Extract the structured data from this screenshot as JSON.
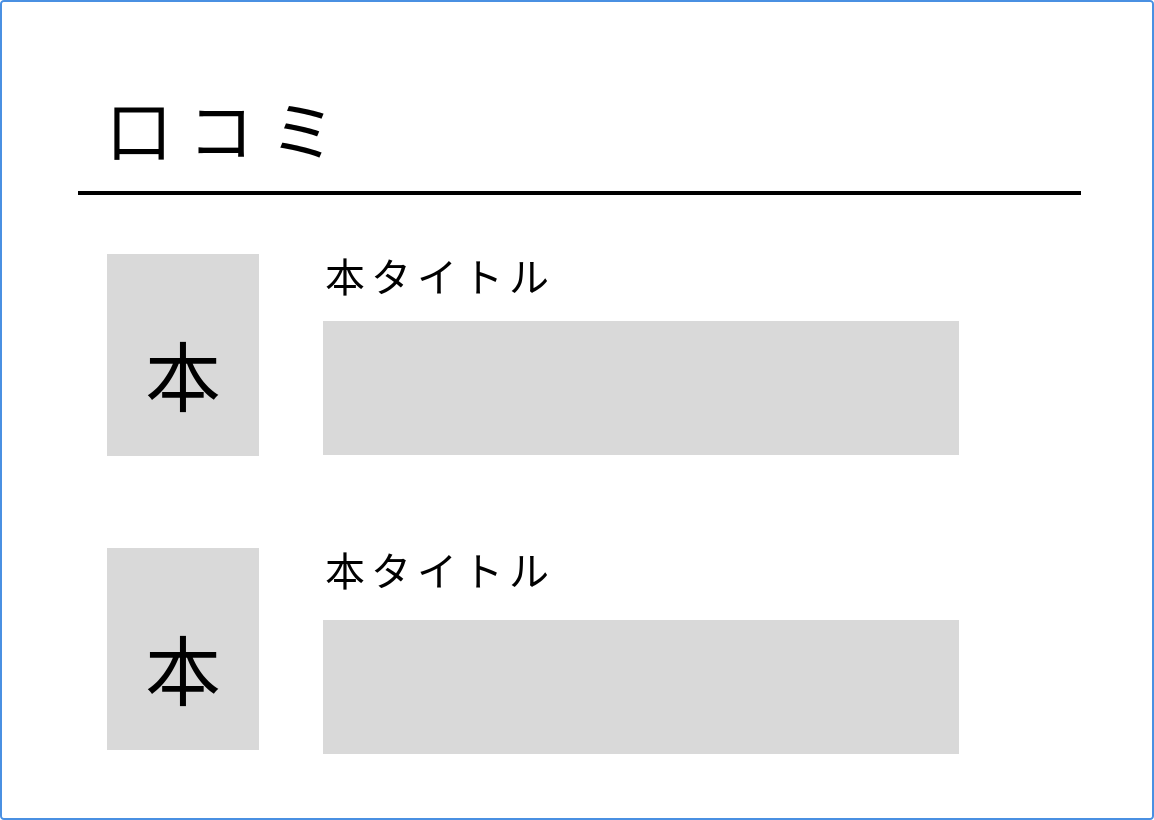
{
  "page": {
    "title": "口コミ"
  },
  "reviews": [
    {
      "cover_label": "本",
      "book_title": "本タイトル",
      "review_text": ""
    },
    {
      "cover_label": "本",
      "book_title": "本タイトル",
      "review_text": ""
    }
  ],
  "colors": {
    "frame_border": "#4a90e2",
    "placeholder_gray": "#d9d9d9",
    "text": "#000000"
  }
}
